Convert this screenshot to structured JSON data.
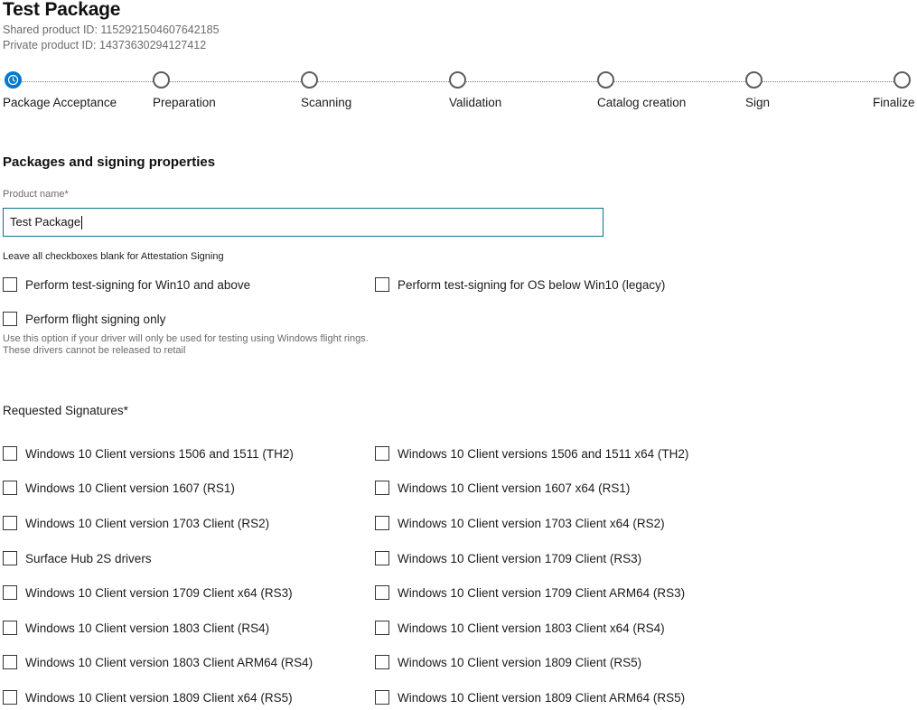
{
  "package": {
    "title": "Test Package",
    "shared_id": "Shared product ID: 1152921504607642185",
    "private_id": "Private product ID: 14373630294127412"
  },
  "stepper": {
    "steps": [
      {
        "label": "Package Acceptance",
        "state": "active"
      },
      {
        "label": "Preparation",
        "state": "pending"
      },
      {
        "label": "Scanning",
        "state": "pending"
      },
      {
        "label": "Validation",
        "state": "pending"
      },
      {
        "label": "Catalog creation",
        "state": "pending"
      },
      {
        "label": "Sign",
        "state": "pending"
      },
      {
        "label": "Finalize",
        "state": "pending"
      }
    ]
  },
  "form": {
    "section_title": "Packages and signing properties",
    "product_name_label": "Product name*",
    "product_name_value": "Test Package",
    "attestation_hint": "Leave all checkboxes blank for Attestation Signing",
    "options": {
      "test_sign_win10": "Perform test-signing for Win10 and above",
      "test_sign_legacy": "Perform test-signing for OS below Win10 (legacy)",
      "flight_only": "Perform flight signing only"
    },
    "flight_note": "Use this option if your driver will only be used for testing using Windows flight rings. These drivers cannot be released to retail",
    "requested_label": "Requested Signatures*",
    "signatures": [
      "Windows 10 Client versions 1506 and 1511 (TH2)",
      "Windows 10 Client versions 1506 and 1511 x64 (TH2)",
      "Windows 10 Client version 1607 (RS1)",
      "Windows 10 Client version 1607 x64 (RS1)",
      "Windows 10 Client version 1703 Client (RS2)",
      "Windows 10 Client version 1703 Client x64 (RS2)",
      "Surface Hub 2S drivers",
      "Windows 10 Client version 1709 Client (RS3)",
      "Windows 10 Client version 1709 Client x64 (RS3)",
      "Windows 10 Client version 1709 Client ARM64 (RS3)",
      "Windows 10 Client version 1803 Client (RS4)",
      "Windows 10 Client version 1803 Client x64 (RS4)",
      "Windows 10 Client version 1803 Client ARM64 (RS4)",
      "Windows 10 Client version 1809 Client (RS5)",
      "Windows 10 Client version 1809 Client x64 (RS5)",
      "Windows 10 Client version 1809 Client ARM64 (RS5)"
    ]
  },
  "colors": {
    "accent": "#0078d4",
    "input_border": "#0a7288"
  }
}
